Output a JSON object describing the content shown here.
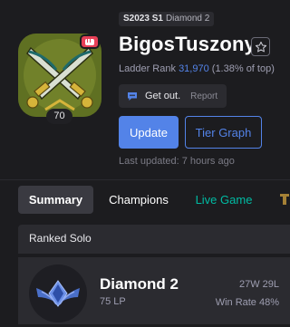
{
  "profile": {
    "season_tier": "S2023 S1",
    "season_rank": "Diamond 2",
    "name": "BigosTuszony",
    "level": "70",
    "ladder_prefix": "Ladder Rank",
    "ladder_rank": "31,970",
    "ladder_percent": "(1.38% of top)",
    "status_message": "Get out.",
    "report_label": "Report",
    "update_label": "Update",
    "tier_graph_label": "Tier Graph",
    "last_updated": "Last updated: 7 hours ago"
  },
  "tabs": [
    {
      "label": "Summary",
      "active": true
    },
    {
      "label": "Champions",
      "active": false
    },
    {
      "label": "Live Game",
      "active": false
    }
  ],
  "ranked": {
    "title": "Ranked Solo",
    "tier": "Diamond 2",
    "lp": "75 LP",
    "record": "27W 29L",
    "win_rate": "Win Rate 48%"
  },
  "colors": {
    "accent": "#5383e8",
    "live": "#00bba3",
    "badge": "#e84057",
    "background": "#1c1c1f",
    "panel": "#2b2b30"
  },
  "icons": {
    "favorite": "star-icon",
    "status": "chat-bubble-icon",
    "avatar_badge": "fist-icon",
    "rank": "diamond-emblem-icon"
  }
}
